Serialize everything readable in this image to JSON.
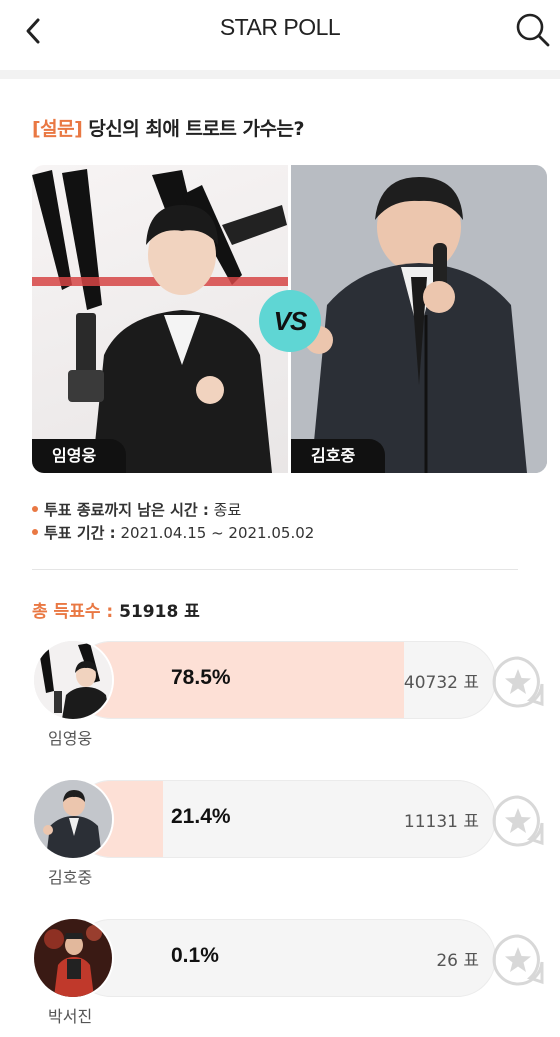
{
  "header": {
    "title": "STAR POLL",
    "back_icon": "chevron-left-icon",
    "search_icon": "search-icon"
  },
  "question": {
    "tag": "[설문]",
    "text": "당신의 최애 트로트 가수는?"
  },
  "matchup": {
    "left_name": "임영웅",
    "right_name": "김호중",
    "vs_label": "VS"
  },
  "info": {
    "remaining_label": "투표 종료까지 남은 시간 :",
    "remaining_value": "종료",
    "period_label": "투표 기간 :",
    "period_value": "2021.04.15 ~ 2021.05.02"
  },
  "total": {
    "label": "총 득표수 :",
    "value": "51918 표"
  },
  "results": [
    {
      "name": "임영웅",
      "percent_text": "78.5%",
      "percent": 78.5,
      "votes": "40732 표"
    },
    {
      "name": "김호중",
      "percent_text": "21.4%",
      "percent": 21.4,
      "votes": "11131 표"
    },
    {
      "name": "박서진",
      "percent_text": "0.1%",
      "percent": 0.1,
      "votes": "26 표"
    }
  ],
  "colors": {
    "accent": "#e97843",
    "bar_fill": "#fde0d6",
    "vs_badge": "#5fd6d4"
  },
  "vote_icon": "star-vote-icon"
}
